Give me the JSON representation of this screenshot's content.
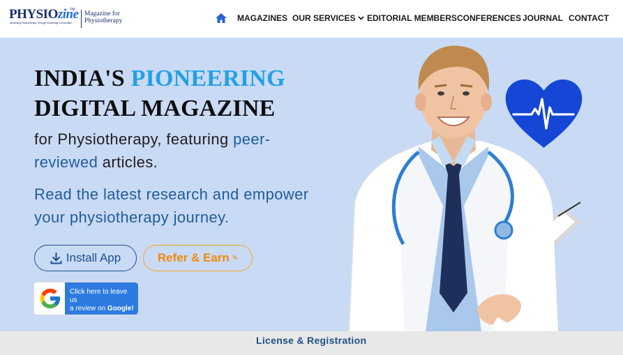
{
  "brand": {
    "logo_main": "PHYSIO",
    "logo_accent": "zine",
    "logo_tm": "TM",
    "tagline": "Advancing Physiotherapy Through Knowledge & Innovation",
    "subtitle": "Magazine for Physiotherapy"
  },
  "nav": {
    "home_icon": "home-icon",
    "items": [
      {
        "label": "MAGAZINES"
      },
      {
        "label": "OUR SERVICES",
        "has_dropdown": true
      },
      {
        "label": "EDITORIAL MEMBERS"
      },
      {
        "label": "CONFERENCES"
      },
      {
        "label": "JOURNAL"
      },
      {
        "label": "CONTACT"
      }
    ]
  },
  "hero": {
    "headline_part1": "INDIA'S ",
    "headline_accent": "PIONEERING",
    "headline_line2": "DIGITAL MAGAZINE",
    "sub1_before": "for Physiotherapy, featuring ",
    "sub1_highlight": "peer-reviewed",
    "sub1_after": " articles.",
    "sub2": "Read the latest research and empower your physiotherapy journey.",
    "install_button": "Install App",
    "refer_button": "Refer & Earn",
    "google_badge_line1": "Click here to leave us",
    "google_badge_line2": "a review on ",
    "google_badge_bold": "Google!"
  },
  "footer_bar": {
    "link": "License & Registration"
  },
  "colors": {
    "hero_bg": "#c9daf5",
    "accent_blue": "#21a0e6",
    "dark_blue": "#1f5d99",
    "refer_orange": "#f08a0c",
    "heart_blue": "#1546d6"
  }
}
